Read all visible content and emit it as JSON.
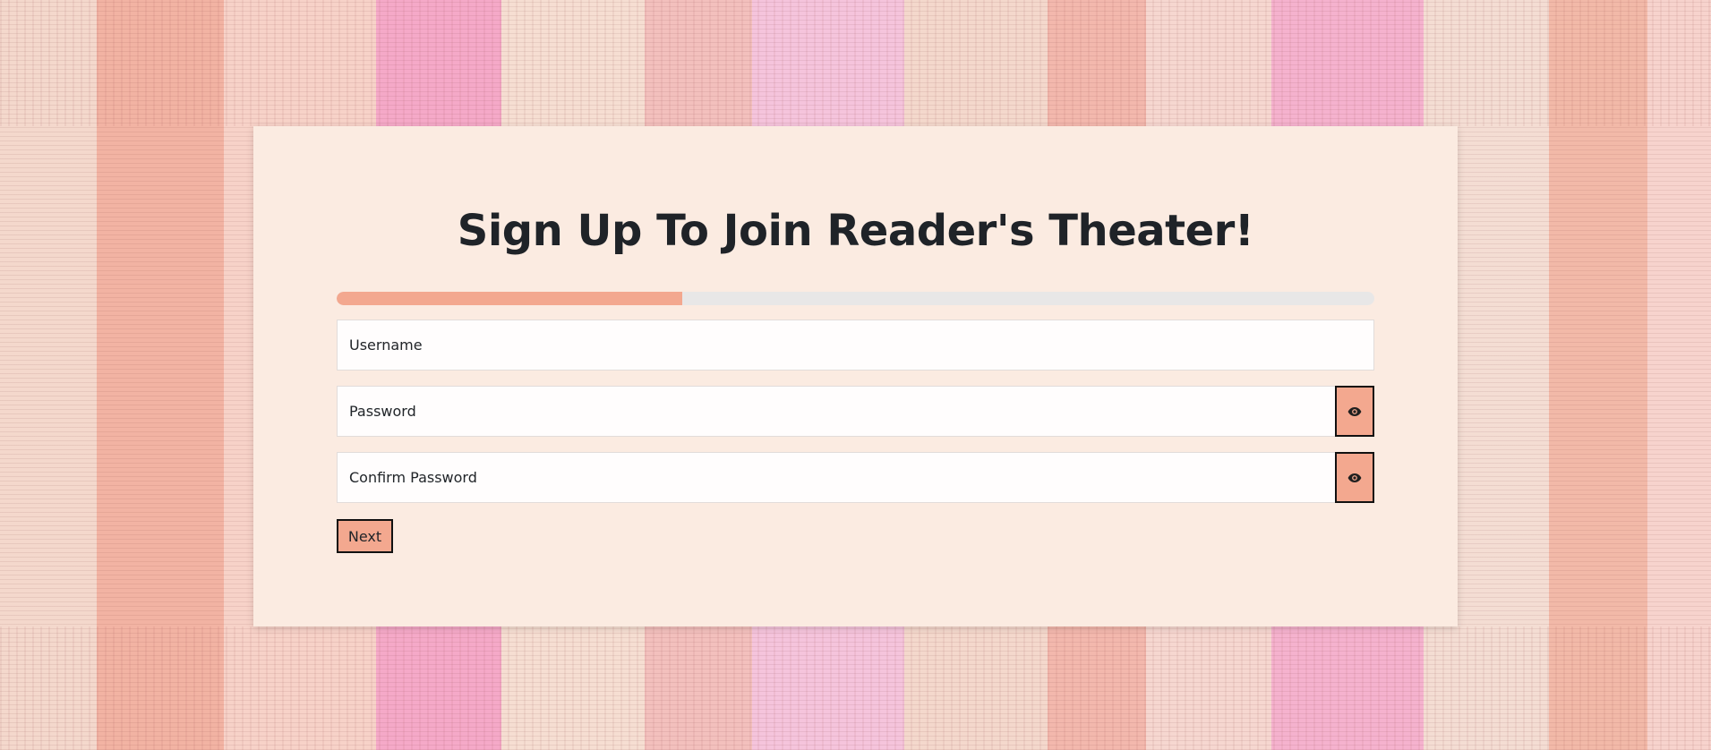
{
  "form": {
    "title": "Sign Up To Join Reader's Theater!",
    "progress_percent": 33.3,
    "username": {
      "placeholder": "Username",
      "value": ""
    },
    "password": {
      "placeholder": "Password",
      "value": "",
      "toggle_icon": "eye-icon"
    },
    "confirm_password": {
      "placeholder": "Confirm Password",
      "value": "",
      "toggle_icon": "eye-icon"
    },
    "next_label": "Next"
  },
  "colors": {
    "accent": "#f3a88f",
    "card_background": "#fbebe1",
    "progress_track": "#e8e7e7",
    "title_text": "#1f2328"
  }
}
